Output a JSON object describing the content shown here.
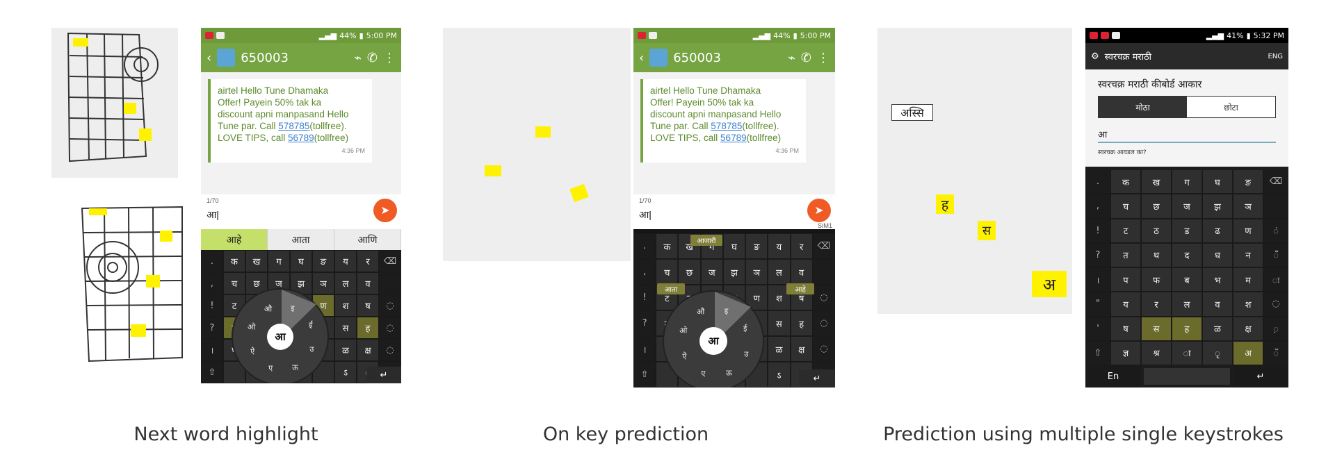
{
  "panels": [
    {
      "caption": "Next word highlight",
      "status": {
        "battery": "44%",
        "time": "5:00 PM"
      },
      "appbar": {
        "contact": "650003"
      },
      "message": {
        "line1": "airtel Hello Tune Dhamaka",
        "line2": "Offer! Payein 50% tak ka",
        "line3": "discount apni manpasand Hello",
        "line4a": "Tune par. Call ",
        "link1": "578785",
        "line4b": "(tollfree).",
        "line5a": "LOVE TIPS, call ",
        "link2": "56789",
        "line5b": "(tollfree)",
        "time": "4:36 PM"
      },
      "compose": {
        "counter": "1/70",
        "text": "आ|"
      },
      "suggestions": [
        "आहे",
        "आता",
        "आणि"
      ],
      "center_key": "आ",
      "enter": "↵"
    },
    {
      "caption": "On key prediction",
      "status": {
        "battery": "44%",
        "time": "5:00 PM"
      },
      "appbar": {
        "contact": "650003"
      },
      "message": {
        "line1": "airtel Hello Tune Dhamaka",
        "line2": "Offer! Payein 50% tak ka",
        "line3": "discount apni manpasand Hello",
        "line4a": "Tune par. Call ",
        "link1": "578785",
        "line4b": "(tollfree).",
        "line5a": "LOVE TIPS, call ",
        "link2": "56789",
        "line5b": "(tollfree)",
        "time": "4:36 PM"
      },
      "compose": {
        "counter": "1/70",
        "text": "आ|",
        "sim": "SIM1"
      },
      "popups": [
        "आजारी",
        "आता",
        "आहे"
      ],
      "center_key": "आ",
      "enter": "↵"
    },
    {
      "caption": "Prediction using multiple single keystrokes",
      "status": {
        "battery": "41%",
        "time": "5:32 PM"
      },
      "settings": {
        "app_title": "स्वरचक्र मराठी",
        "lang": "ENG",
        "heading": "स्वरचक्र मराठी कीबोर्ड आकार",
        "seg_big": "मोठा",
        "seg_small": "छोटा",
        "input_value": "आ",
        "question": "स्वरचक्र आवडल का?"
      },
      "lang_key": "En",
      "enter": "↵",
      "paper_labels": {
        "top": "अस्सि",
        "k1": "ह",
        "k2": "स",
        "k3": "अ"
      }
    }
  ],
  "keyboard_rows_ab": [
    [
      ".",
      "क",
      "ख",
      "ग",
      "घ",
      "ङ",
      "य",
      "र",
      "⌫"
    ],
    [
      ",",
      "च",
      "छ",
      "ज",
      "झ",
      "ञ",
      "ल",
      "व",
      ""
    ],
    [
      "!",
      "ट",
      "ठ",
      "ड",
      "ढ",
      "ण",
      "श",
      "ष",
      "◌"
    ],
    [
      "?",
      "त",
      "थ",
      "द",
      "ध",
      "न",
      "स",
      "ह",
      "◌"
    ],
    [
      "।",
      "प",
      "फ",
      "ब",
      "भ",
      "म",
      "ळ",
      "क्ष",
      "◌"
    ],
    [
      "⇧",
      "",
      "",
      "",
      "",
      "",
      "ऽ",
      "ं",
      "◌"
    ]
  ],
  "keyboard_rows_c": [
    [
      ".",
      "क",
      "ख",
      "ग",
      "घ",
      "ङ",
      "⌫"
    ],
    [
      ",",
      "च",
      "छ",
      "ज",
      "झ",
      "ञ",
      ""
    ],
    [
      "!",
      "ट",
      "ठ",
      "ड",
      "ढ",
      "ण",
      "ं"
    ],
    [
      "?",
      "त",
      "थ",
      "द",
      "ध",
      "न",
      "ँ"
    ],
    [
      "।",
      "प",
      "फ",
      "ब",
      "भ",
      "म",
      "ः"
    ],
    [
      "\"",
      "य",
      "र",
      "ल",
      "व",
      "श",
      "◌"
    ],
    [
      "'",
      "ष",
      "स",
      "ह",
      "ळ",
      "क्ष",
      "़"
    ],
    [
      "⇧",
      "ज्ञ",
      "श्र",
      "ा",
      "ृ",
      "अ",
      "ॅ"
    ]
  ],
  "wheel_labels": [
    "आ",
    "इ",
    "ई",
    "उ",
    "ऊ",
    "ए",
    "ऐ",
    "ओ",
    "औ"
  ]
}
